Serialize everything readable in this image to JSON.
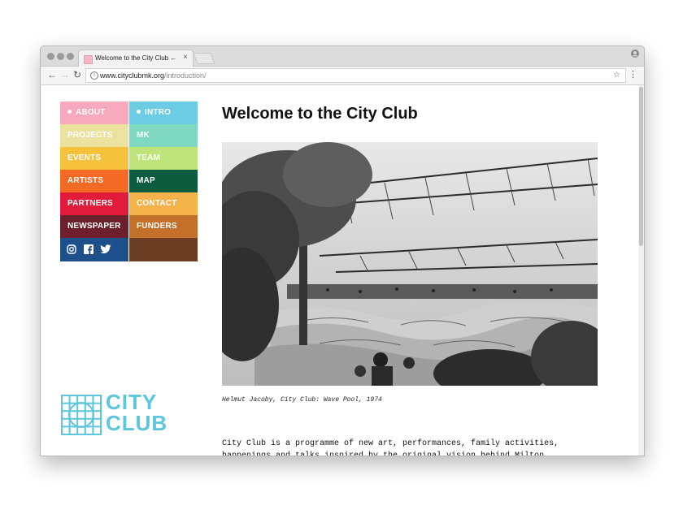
{
  "browser": {
    "tab_title": "Welcome to the City Club ← C",
    "url_host": "www.cityclubmk.org",
    "url_path": "/introduction/"
  },
  "nav": {
    "items": [
      {
        "label": "ABOUT",
        "color": "#f7a9bd",
        "active": true
      },
      {
        "label": "INTRO",
        "color": "#6bcce3",
        "active": true
      },
      {
        "label": "PROJECTS",
        "color": "#ece2a0",
        "active": false
      },
      {
        "label": "MK",
        "color": "#7fd9c1",
        "active": false
      },
      {
        "label": "EVENTS",
        "color": "#f6c23e",
        "active": false
      },
      {
        "label": "TEAM",
        "color": "#bfe57a",
        "active": false
      },
      {
        "label": "ARTISTS",
        "color": "#f26a24",
        "active": false
      },
      {
        "label": "MAP",
        "color": "#0c5c3f",
        "active": false
      },
      {
        "label": "PARTNERS",
        "color": "#e01c3a",
        "active": false
      },
      {
        "label": "CONTACT",
        "color": "#f4b24a",
        "active": false
      },
      {
        "label": "NEWSPAPER",
        "color": "#6d1f2e",
        "active": false
      },
      {
        "label": "FUNDERS",
        "color": "#c4702a",
        "active": false
      }
    ],
    "social_bg": "#1d4f8a",
    "filler_bg": "#6b3d22"
  },
  "page": {
    "title": "Welcome to the City Club",
    "caption": "Helmut Jacoby, City Club: Wave Pool, 1974",
    "intro": "City Club is a programme of new art, performances, family activities, happenings and talks inspired by the original vision behind Milton Keynes."
  },
  "logo": {
    "line1": "CITY",
    "line2": "CLUB",
    "color": "#5cc6dc"
  }
}
